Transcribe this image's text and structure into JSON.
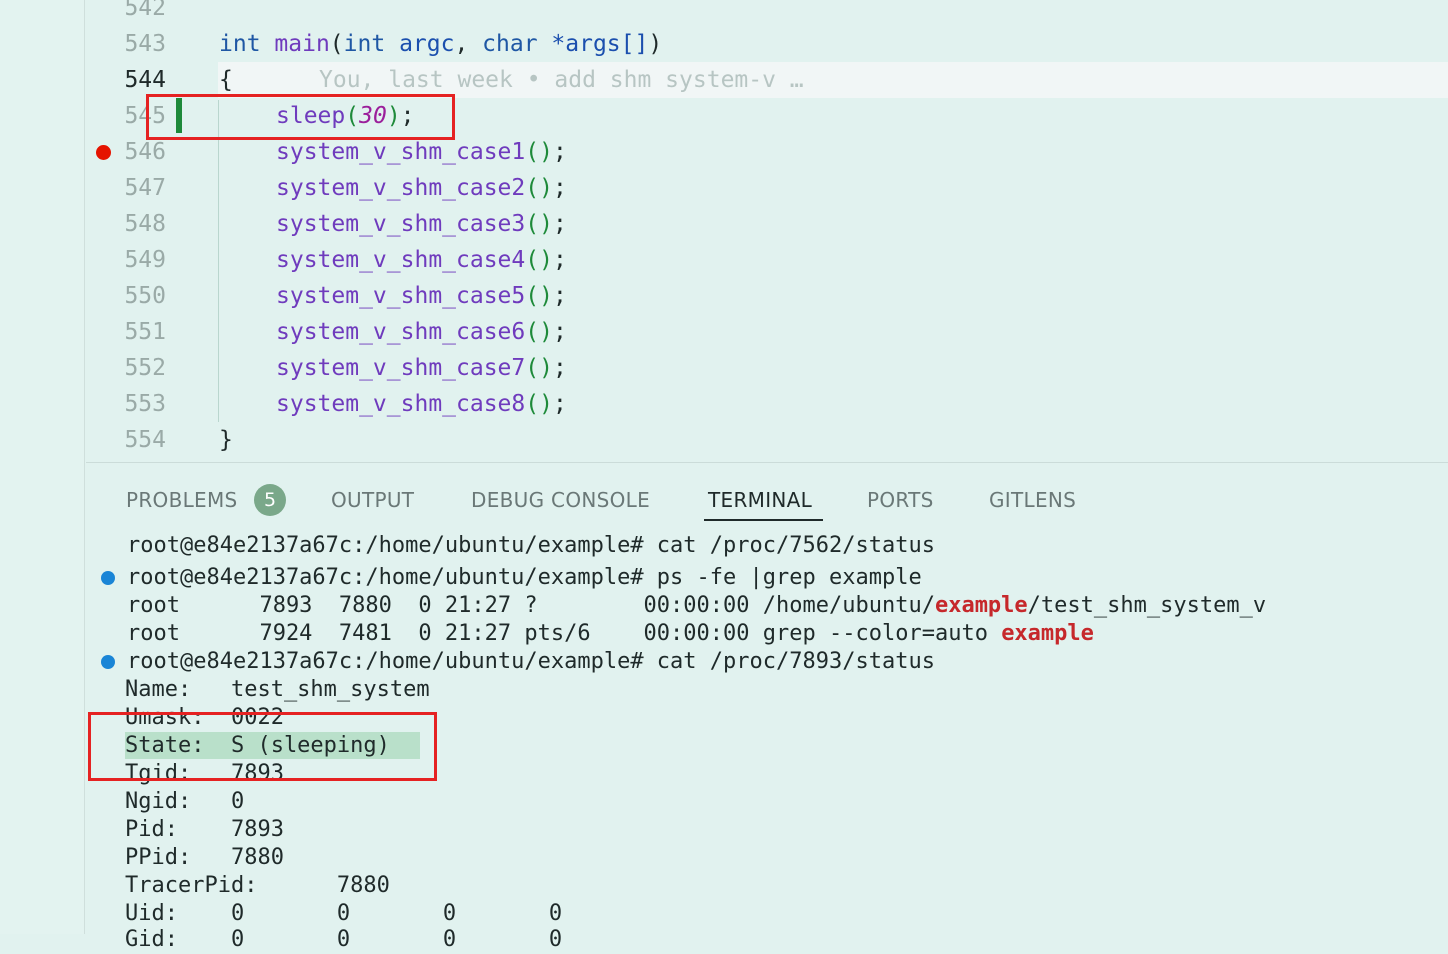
{
  "editor": {
    "lines": [
      {
        "num": "542",
        "code": ""
      },
      {
        "num": "543",
        "code": "int main(int argc, char *args[])"
      },
      {
        "num": "544",
        "code": "{",
        "blame": "You, last week • add shm system-v …"
      },
      {
        "num": "545",
        "code": "sleep(30);",
        "arg": "30"
      },
      {
        "num": "546",
        "code": "system_v_shm_case1();"
      },
      {
        "num": "547",
        "code": "system_v_shm_case2();"
      },
      {
        "num": "548",
        "code": "system_v_shm_case3();"
      },
      {
        "num": "549",
        "code": "system_v_shm_case4();"
      },
      {
        "num": "550",
        "code": "system_v_shm_case5();"
      },
      {
        "num": "551",
        "code": "system_v_shm_case6();"
      },
      {
        "num": "552",
        "code": "system_v_shm_case7();"
      },
      {
        "num": "553",
        "code": "system_v_shm_case8();"
      },
      {
        "num": "554",
        "code": "}"
      }
    ],
    "signature": {
      "kw_int": "int",
      "fn_main": "main",
      "kw_int2": "int",
      "var_argc": "argc",
      "kw_char": "char",
      "var_args": "*args[]"
    },
    "sleep_fn": "sleep",
    "calls": [
      "system_v_shm_case1",
      "system_v_shm_case2",
      "system_v_shm_case3",
      "system_v_shm_case4",
      "system_v_shm_case5",
      "system_v_shm_case6",
      "system_v_shm_case7",
      "system_v_shm_case8"
    ]
  },
  "panel": {
    "tabs": {
      "problems": "PROBLEMS",
      "problems_count": "5",
      "output": "OUTPUT",
      "debug_console": "DEBUG CONSOLE",
      "terminal": "TERMINAL",
      "ports": "PORTS",
      "gitlens": "GITLENS"
    }
  },
  "terminal": {
    "line1": "root@e84e2137a67c:/home/ubuntu/example# cat /proc/7562/status",
    "line2": "root@e84e2137a67c:/home/ubuntu/example# ps -fe |grep example",
    "line3_a": "root      7893  7880  0 21:27 ?        00:00:00 /home/ubuntu/",
    "line3_match": "example",
    "line3_b": "/test_shm_system_v",
    "line4_a": "root      7924  7481  0 21:27 pts/6    00:00:00 grep --color=auto ",
    "line4_match": "example",
    "line5": "root@e84e2137a67c:/home/ubuntu/example# cat /proc/7893/status",
    "status": [
      "Name:   test_shm_system",
      "Umask:  0022",
      "State:  S (sleeping)",
      "Tgid:   7893",
      "Ngid:   0",
      "Pid:    7893",
      "PPid:   7880",
      "TracerPid:      7880",
      "Uid:    0       0       0       0",
      "Gid:    0       0       0       0"
    ]
  }
}
